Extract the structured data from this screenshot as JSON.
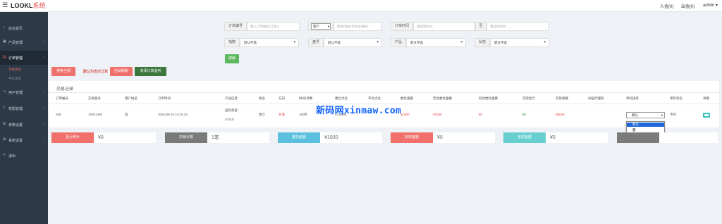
{
  "app": {
    "brand_main": "LOOKL",
    "brand_sub": "系统"
  },
  "topbar": {
    "deposit": "入金(0)",
    "withdraw": "出金(0)",
    "user": "admin"
  },
  "sidebar": {
    "items": [
      {
        "label": "后台首页",
        "icon": "home-icon"
      },
      {
        "label": "产品管理",
        "icon": "box-icon"
      },
      {
        "label": "订单管理",
        "icon": "order-icon"
      },
      {
        "label": "用户管理",
        "icon": "user-icon"
      },
      {
        "label": "权限管理",
        "icon": "lock-icon"
      },
      {
        "label": "参数设置",
        "icon": "gear-icon"
      },
      {
        "label": "系统设置",
        "icon": "settings-icon"
      },
      {
        "label": "退出",
        "icon": "logout-icon"
      }
    ],
    "sub": {
      "active": "交易流水",
      "other": "平仓流水"
    }
  },
  "filters": {
    "order_no_label": "订单编号",
    "order_no_placeholder": "输入订单编号/订单id",
    "client_select": "客户",
    "client_placeholder": "昵称/姓名/手机号/编号",
    "order_time_label": "订单时间",
    "order_time_placeholder": "請选择时间",
    "to_label": "至",
    "to_placeholder": "请选择时间",
    "index_label": "指数",
    "index_value": "默认不选",
    "pan_label": "盘号",
    "pan_value": "默认不选",
    "product_label": "产品",
    "product_value": "默认不选",
    "status_label": "状态",
    "status_value": "默认不选",
    "search_button": "搜索"
  },
  "actions": {
    "search_all": "搜索全部",
    "tip": "默认为当天订单",
    "auto_refresh": "自动刷新",
    "close_monitor": "关闭订单监听"
  },
  "panel": {
    "title": "交易记录",
    "headers": [
      "订单编号",
      "交易盘号",
      "用户姓名",
      "订单时间",
      "产品信息",
      "状态",
      "方向",
      "时间/点数",
      "建仓点位",
      "平仓点位",
      "委托金额",
      "无效委托金额",
      "有效委托金额",
      "实际盈亏",
      "实际余额",
      "扫描代理商",
      "单控操作",
      "单控状态",
      "详情"
    ],
    "row": {
      "order_id": "488",
      "pan_no": "10001469",
      "user_name": "窗",
      "time": "2024-08-18 13:15:23",
      "product_line1": "国际黄金",
      "product_line2": "GOLD",
      "status": "建仓",
      "direction": "买涨",
      "duration": "180秒",
      "open_price": "14.6486",
      "close_price": "",
      "amount": "¥1000",
      "invalid_amount": "¥1000",
      "valid_amount": "¥0",
      "pnl": "¥0",
      "balance": "¥8040",
      "agent": "",
      "control_select": "默认",
      "control_status": "不控"
    }
  },
  "dropdown": {
    "options": [
      "默认",
      "赢",
      "亏"
    ],
    "selected_index": 0
  },
  "watermark": "新码网xinmaw.com",
  "summary": [
    {
      "label": "盈亏统计",
      "value": "¥0",
      "color": "#f0706b"
    },
    {
      "label": "交易手数",
      "value": "1笔",
      "color": "#7a7a7a"
    },
    {
      "label": "委托金额",
      "value": "¥1000",
      "color": "#5bc0de"
    },
    {
      "label": "有效金额",
      "value": "¥0",
      "color": "#f0706b"
    },
    {
      "label": "无效金额",
      "value": "¥0",
      "color": "#67cfd0"
    },
    {
      "label": "",
      "value": "",
      "color": "#7a7a7a"
    }
  ]
}
